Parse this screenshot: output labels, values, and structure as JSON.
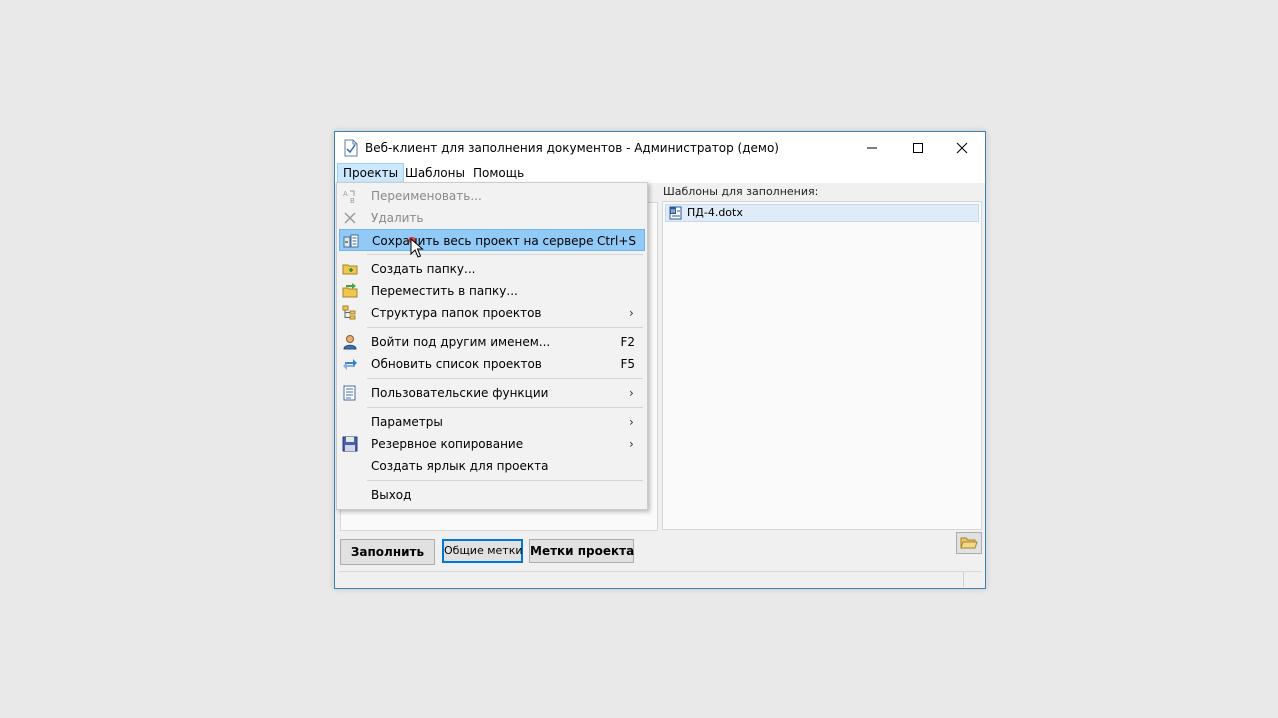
{
  "window": {
    "title": "Веб-клиент для заполнения документов - Администратор (демо)",
    "controls": [
      "minimize-icon",
      "maximize-icon",
      "close-icon"
    ]
  },
  "menubar": {
    "items": [
      "Проекты",
      "Шаблоны",
      "Помощь"
    ],
    "active": "Проекты"
  },
  "right_panel": {
    "label": "Шаблоны для заполнения:",
    "items": [
      {
        "name": "ПД-4.dotx",
        "icon": "word-document-icon"
      }
    ]
  },
  "buttons": {
    "fill": "Заполнить",
    "common_tags": "Общие метки",
    "project_tags": "Метки проекта",
    "open_folder_icon": "open-folder-icon"
  },
  "dropdown": {
    "items": [
      {
        "label": "Переименовать...",
        "disabled": true,
        "icon": "rename-icon"
      },
      {
        "label": "Удалить",
        "disabled": true,
        "icon": "delete-icon"
      },
      {
        "label": "Сохранить весь проект на сервере",
        "shortcut": "Ctrl+S",
        "highlighted": true,
        "icon": "server-save-icon"
      },
      {
        "label": "Создать папку...",
        "icon": "new-folder-icon"
      },
      {
        "label": "Переместить в папку...",
        "icon": "move-to-folder-icon"
      },
      {
        "label": "Структура папок проектов",
        "submenu": true,
        "icon": "folder-tree-icon"
      },
      {
        "label": "Войти под другим именем...",
        "shortcut": "F2",
        "icon": "user-icon"
      },
      {
        "label": "Обновить список проектов",
        "shortcut": "F5",
        "icon": "refresh-icon"
      },
      {
        "label": "Пользовательские функции",
        "submenu": true,
        "icon": "custom-functions-icon"
      },
      {
        "label": "Параметры",
        "submenu": true
      },
      {
        "label": "Резервное копирование",
        "submenu": true,
        "icon": "backup-icon"
      },
      {
        "label": "Создать ярлык для проекта"
      },
      {
        "label": "Выход"
      }
    ]
  },
  "colors": {
    "highlight": "#91c9f7",
    "menu_active": "#cce8ff",
    "window_border": "#3c7fb1",
    "focus_border": "#0078d7"
  }
}
